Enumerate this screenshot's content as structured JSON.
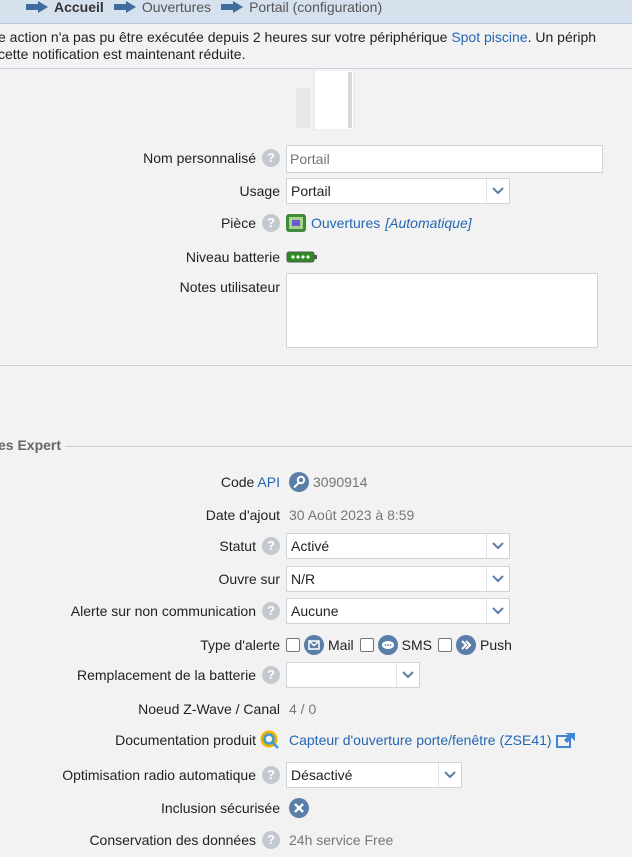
{
  "breadcrumb": {
    "items": [
      {
        "label": "Accueil",
        "bold": true
      },
      {
        "label": "Ouvertures",
        "bold": false
      },
      {
        "label": "Portail (configuration)",
        "bold": false
      }
    ]
  },
  "notice": {
    "line1_prefix": "e action n'a pas pu être exécutée depuis 2 heures sur votre périphérique ",
    "line1_link": "Spot piscine",
    "line1_suffix": ". Un périph",
    "line2": "cette notification est maintenant réduite."
  },
  "form": {
    "name_label": "Nom personnalisé",
    "name_placeholder": "Portail",
    "usage_label": "Usage",
    "usage_value": "Portail",
    "room_label": "Pièce",
    "room_link": "Ouvertures",
    "room_auto": "[Automatique]",
    "battery_label": "Niveau batterie",
    "notes_label": "Notes utilisateur",
    "notes_value": ""
  },
  "expert": {
    "section_title": "es Expert",
    "api_label_prefix": "Code ",
    "api_label_link": "API",
    "api_value": "3090914",
    "date_label": "Date d'ajout",
    "date_value": "30 Août 2023 à 8:59",
    "status_label": "Statut",
    "status_value": "Activé",
    "opens_label": "Ouvre sur",
    "opens_value": "N/R",
    "alert_nocomm_label": "Alerte sur non communication",
    "alert_nocomm_value": "Aucune",
    "alert_type_label": "Type d'alerte",
    "alert_types": {
      "mail": "Mail",
      "sms": "SMS",
      "push": "Push"
    },
    "battery_replace_label": "Remplacement de la batterie",
    "battery_replace_value": "",
    "zwave_label": "Noeud Z-Wave / Canal",
    "zwave_value": "4 / 0",
    "doc_label": "Documentation produit",
    "doc_link": "Capteur d'ouverture porte/fenêtre (ZSE41)",
    "radio_label": "Optimisation radio automatique",
    "radio_value": "Désactivé",
    "secure_label": "Inclusion sécurisée",
    "retention_label": "Conservation des données",
    "retention_value": "24h service Free"
  },
  "colors": {
    "link": "#2467b3",
    "breadcrumb_bg": "#d6e1ee",
    "page_bg": "#f2f2f2",
    "battery": "#2e8b22"
  }
}
